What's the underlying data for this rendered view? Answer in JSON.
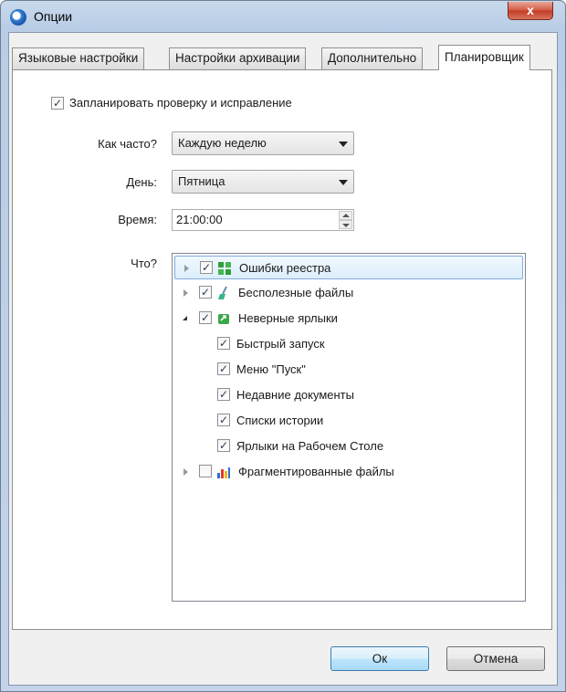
{
  "window": {
    "title": "Опции",
    "close_label": "x"
  },
  "tabs": [
    {
      "label": "Языковые настройки"
    },
    {
      "label": "Настройки архивации"
    },
    {
      "label": "Дополнительно"
    },
    {
      "label": "Планировщик",
      "active": true
    }
  ],
  "scheduler": {
    "enable_label": "Запланировать проверку и исправление",
    "enable_checked": true,
    "frequency_label": "Как часто?",
    "frequency_value": "Каждую неделю",
    "day_label": "День:",
    "day_value": "Пятница",
    "time_label": "Время:",
    "time_value": "21:00:00",
    "what_label": "Что?"
  },
  "tree": [
    {
      "label": "Ошибки реестра",
      "checked": true,
      "expander": "collapsed",
      "icon": "registry-icon",
      "selected": true
    },
    {
      "label": "Бесполезные файлы",
      "checked": true,
      "expander": "collapsed",
      "icon": "broom-icon"
    },
    {
      "label": "Неверные ярлыки",
      "checked": true,
      "expander": "expanded",
      "icon": "shortcut-icon",
      "children": [
        {
          "label": "Быстрый запуск",
          "checked": true
        },
        {
          "label": "Меню \"Пуск\"",
          "checked": true
        },
        {
          "label": "Недавние документы",
          "checked": true
        },
        {
          "label": "Списки истории",
          "checked": true
        },
        {
          "label": "Ярлыки на Рабочем Столе",
          "checked": true
        }
      ]
    },
    {
      "label": "Фрагментированные файлы",
      "checked": false,
      "expander": "collapsed",
      "icon": "defrag-icon"
    }
  ],
  "buttons": {
    "ok": "Ок",
    "cancel": "Отмена"
  },
  "check_mark": "✓"
}
